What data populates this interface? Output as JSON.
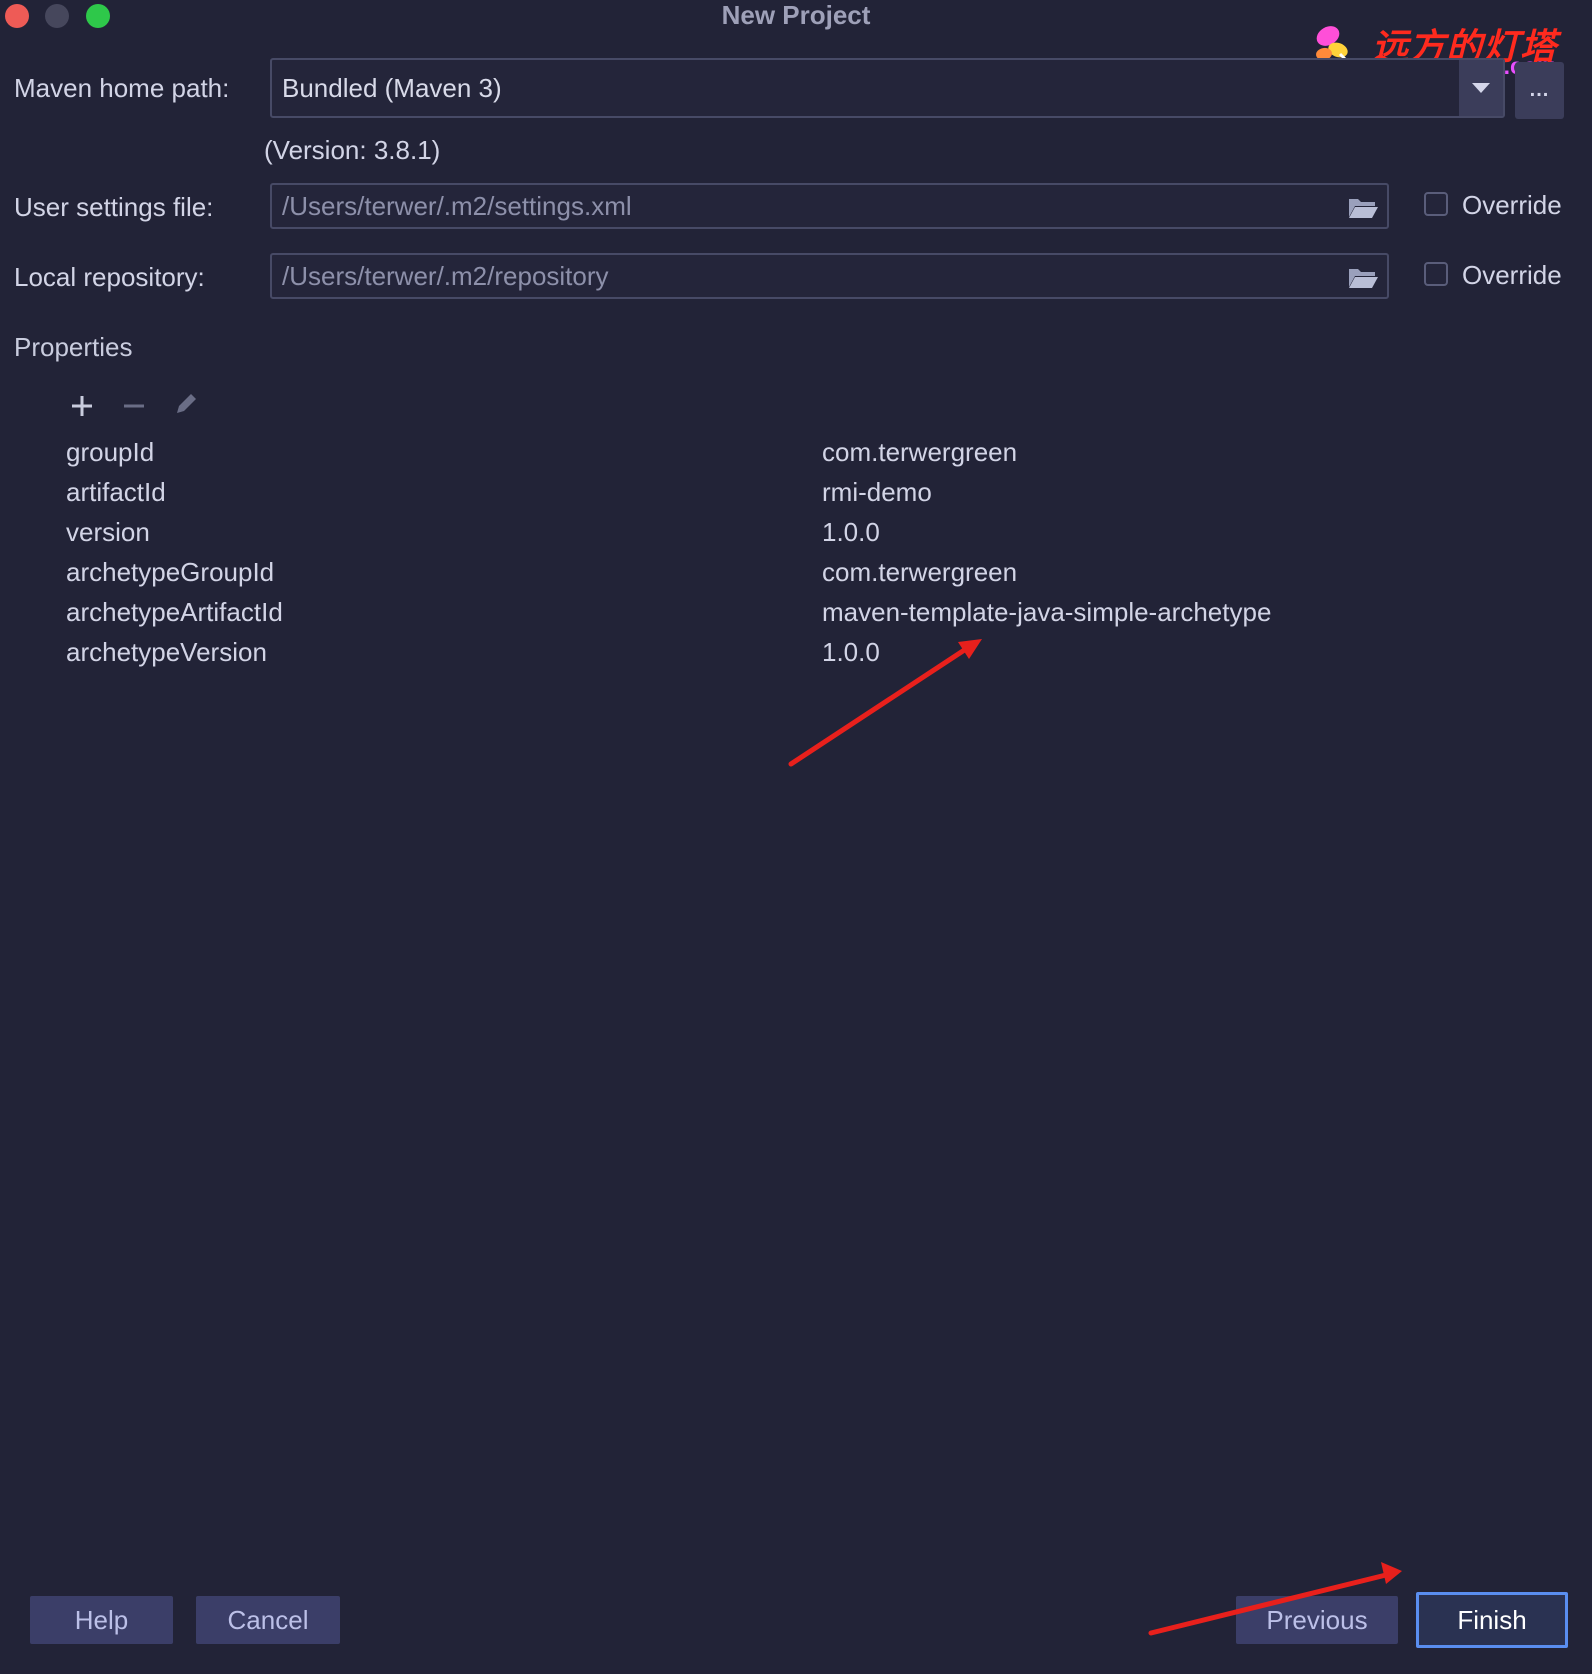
{
  "window": {
    "title": "New Project"
  },
  "watermark": {
    "cn": "远方的灯塔",
    "en": "terwergreen.com"
  },
  "form": {
    "maven_home_label": "Maven home path:",
    "maven_home_value": "Bundled (Maven 3)",
    "more_button": "...",
    "version_note": "(Version: 3.8.1)",
    "user_settings_label": "User settings file:",
    "user_settings_value": "/Users/terwer/.m2/settings.xml",
    "local_repo_label": "Local repository:",
    "local_repo_value": "/Users/terwer/.m2/repository",
    "override_label": "Override"
  },
  "properties": {
    "title": "Properties",
    "rows": [
      {
        "key": "groupId",
        "value": "com.terwergreen"
      },
      {
        "key": "artifactId",
        "value": "rmi-demo"
      },
      {
        "key": "version",
        "value": "1.0.0"
      },
      {
        "key": "archetypeGroupId",
        "value": "com.terwergreen"
      },
      {
        "key": "archetypeArtifactId",
        "value": "maven-template-java-simple-archetype"
      },
      {
        "key": "archetypeVersion",
        "value": "1.0.0"
      }
    ]
  },
  "buttons": {
    "help": "Help",
    "cancel": "Cancel",
    "previous": "Previous",
    "finish": "Finish"
  },
  "colors": {
    "background": "#222337",
    "annotation_arrow": "#e8201c",
    "primary_border": "#5a8ef0"
  }
}
